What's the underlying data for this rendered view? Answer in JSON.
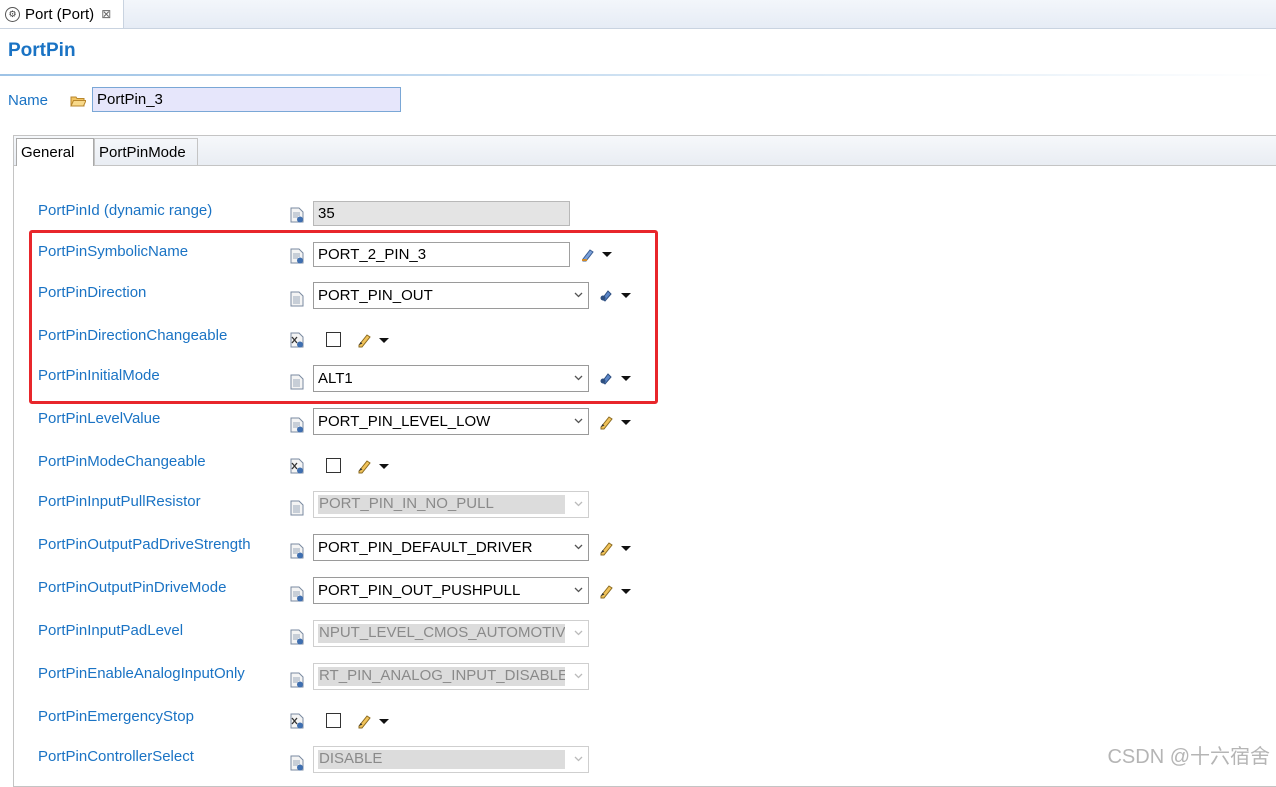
{
  "editor_tab": {
    "title": "Port (Port)",
    "close": "⊠"
  },
  "form_title": "PortPin",
  "name": {
    "label": "Name",
    "value": "PortPin_3"
  },
  "tabs": [
    {
      "label": "General",
      "active": true
    },
    {
      "label": "PortPinMode",
      "active": false
    }
  ],
  "props": {
    "pin_id": {
      "label": "PortPinId (dynamic range)",
      "value": "35"
    },
    "symbolic_name": {
      "label": "PortPinSymbolicName",
      "value": "PORT_2_PIN_3"
    },
    "direction": {
      "label": "PortPinDirection",
      "value": "PORT_PIN_OUT"
    },
    "direction_changeable": {
      "label": "PortPinDirectionChangeable",
      "checked": false
    },
    "initial_mode": {
      "label": "PortPinInitialMode",
      "value": "ALT1"
    },
    "level_value": {
      "label": "PortPinLevelValue",
      "value": "PORT_PIN_LEVEL_LOW"
    },
    "mode_changeable": {
      "label": "PortPinModeChangeable",
      "checked": false
    },
    "input_pull": {
      "label": "PortPinInputPullResistor",
      "value": "PORT_PIN_IN_NO_PULL",
      "disabled": true
    },
    "pad_drive": {
      "label": "PortPinOutputPadDriveStrength",
      "value": "PORT_PIN_DEFAULT_DRIVER"
    },
    "pin_drive_mode": {
      "label": "PortPinOutputPinDriveMode",
      "value": "PORT_PIN_OUT_PUSHPULL"
    },
    "input_pad_level": {
      "label": "PortPinInputPadLevel",
      "value": "NPUT_LEVEL_CMOS_AUTOMOTIVE",
      "disabled": true
    },
    "analog_input_only": {
      "label": "PortPinEnableAnalogInputOnly",
      "value": "RT_PIN_ANALOG_INPUT_DISABLE",
      "disabled": true
    },
    "emergency_stop": {
      "label": "PortPinEmergencyStop",
      "checked": false
    },
    "controller_select": {
      "label": "PortPinControllerSelect",
      "value": "DISABLE",
      "disabled": true
    }
  },
  "watermark": "CSDN @十六宿舍",
  "colors": {
    "label_blue": "#1a73c4",
    "highlight_red": "#e8262b"
  }
}
